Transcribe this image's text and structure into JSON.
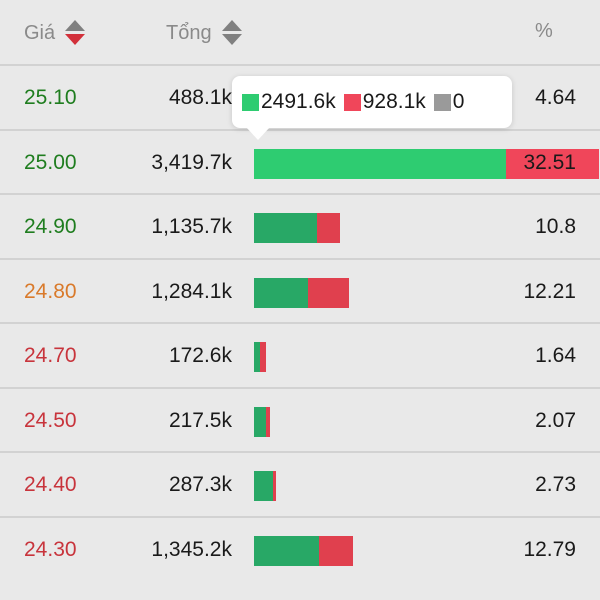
{
  "header": {
    "price_label": "Giá",
    "total_label": "Tổng",
    "pct_label": "%"
  },
  "colors": {
    "up": "#1f7d1f",
    "ref": "#d97a2b",
    "down": "#c8343c",
    "buy": "#28a866",
    "sell": "#e0404e",
    "neutral": "#9a9a9a"
  },
  "tooltip": {
    "buy": "2491.6k",
    "sell": "928.1k",
    "neutral": "0"
  },
  "rows": [
    {
      "price": "25.10",
      "total": "488.1k",
      "pct": "4.64",
      "trend": "up",
      "buy_frac": 0.0,
      "sell_frac": 0.0
    },
    {
      "price": "25.00",
      "total": "3,419.7k",
      "pct": "32.51",
      "trend": "up",
      "buy_frac": 0.729,
      "sell_frac": 0.271
    },
    {
      "price": "24.90",
      "total": "1,135.7k",
      "pct": "10.8",
      "trend": "up",
      "buy_frac": 0.183,
      "sell_frac": 0.065
    },
    {
      "price": "24.80",
      "total": "1,284.1k",
      "pct": "12.21",
      "trend": "ref",
      "buy_frac": 0.156,
      "sell_frac": 0.119
    },
    {
      "price": "24.70",
      "total": "172.6k",
      "pct": "1.64",
      "trend": "down",
      "buy_frac": 0.018,
      "sell_frac": 0.018
    },
    {
      "price": "24.50",
      "total": "217.5k",
      "pct": "2.07",
      "trend": "down",
      "buy_frac": 0.036,
      "sell_frac": 0.009
    },
    {
      "price": "24.40",
      "total": "287.3k",
      "pct": "2.73",
      "trend": "down",
      "buy_frac": 0.054,
      "sell_frac": 0.009
    },
    {
      "price": "24.30",
      "total": "1,345.2k",
      "pct": "12.79",
      "trend": "down",
      "buy_frac": 0.187,
      "sell_frac": 0.101
    }
  ]
}
